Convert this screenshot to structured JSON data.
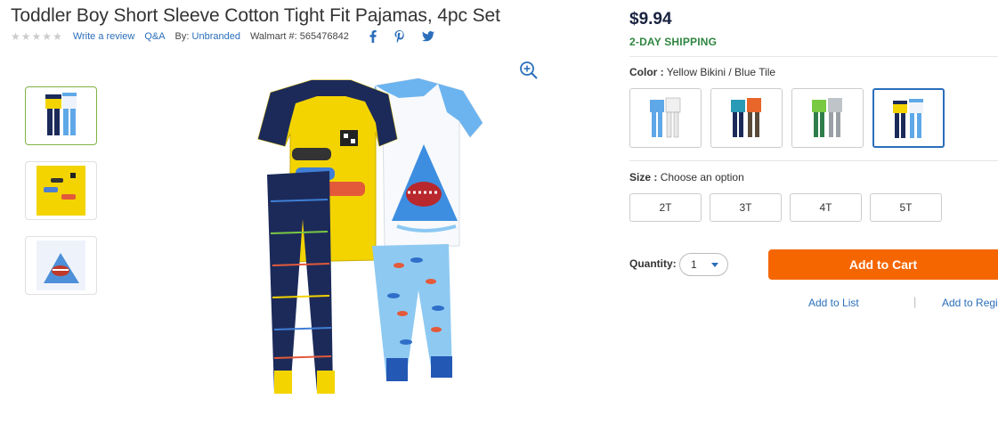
{
  "product": {
    "title": "Toddler Boy Short Sleeve Cotton Tight Fit Pajamas, 4pc Set",
    "rating_stars": 5,
    "write_review": "Write a review",
    "qa": "Q&A",
    "by_label": "By:",
    "brand": "Unbranded",
    "walmart_num_label": "Walmart #:",
    "walmart_num": "565476842"
  },
  "social": [
    "facebook-icon",
    "pinterest-icon",
    "twitter-icon"
  ],
  "price": "$9.94",
  "shipping": "2-DAY SHIPPING",
  "color": {
    "label": "Color :",
    "value": "Yellow Bikini / Blue Tile",
    "swatches": [
      "blue-white-set",
      "navy-orange-set",
      "green-gray-set",
      "yellow-blue-set"
    ],
    "selected_index": 3
  },
  "size": {
    "label": "Size :",
    "value": "Choose an option",
    "options": [
      "2T",
      "3T",
      "4T",
      "5T"
    ]
  },
  "quantity": {
    "label": "Quantity:",
    "value": "1"
  },
  "buttons": {
    "add_to_cart": "Add to Cart",
    "add_to_list": "Add to List",
    "separator": "|",
    "add_to_registry": "Add to Registry"
  },
  "colors": {
    "brand_blue": "#2a6ebb",
    "cart_orange": "#f56600",
    "shipping_green": "#2e8540",
    "selected_thumb_green": "#7db343"
  }
}
